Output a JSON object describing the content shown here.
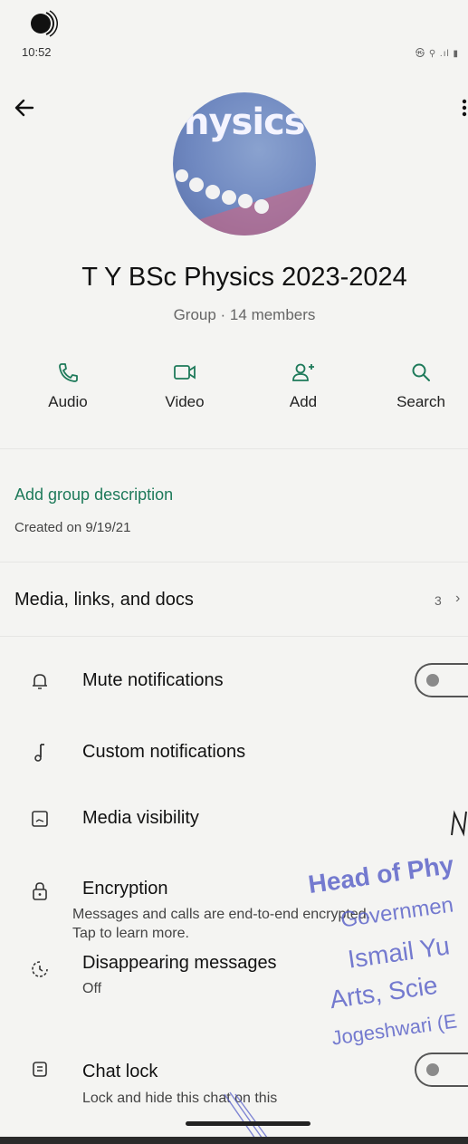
{
  "status_bar": {
    "time": "10:52",
    "icons_text": "㉿ ⚲ .ıl ▮"
  },
  "group": {
    "name": "T Y BSc Physics 2023-2024",
    "subtitle": "Group · 14 members",
    "avatar_text": "hysics"
  },
  "actions": [
    {
      "label": "Audio",
      "icon": "phone-icon"
    },
    {
      "label": "Video",
      "icon": "video-icon"
    },
    {
      "label": "Add",
      "icon": "add-person-icon"
    },
    {
      "label": "Search",
      "icon": "search-icon"
    }
  ],
  "description": {
    "add_link": "Add group description",
    "created": "Created on 9/19/21"
  },
  "media": {
    "title": "Media, links, and docs",
    "count": "3",
    "chevron": "›"
  },
  "settings": {
    "mute": {
      "title": "Mute notifications"
    },
    "custom": {
      "title": "Custom notifications"
    },
    "visibility": {
      "title": "Media visibility"
    },
    "encryption": {
      "title": "Encryption",
      "subtitle_line1": "Messages and calls are end-to-end encrypted.",
      "subtitle_line2": "Tap to learn more."
    },
    "disappearing": {
      "title": "Disappearing messages",
      "value": "Off"
    },
    "chat_lock": {
      "title": "Chat lock",
      "subtitle": "Lock and hide this chat on this"
    }
  },
  "stamp": {
    "line1": "Head of Phy",
    "line2": "Governmen",
    "line3": "Ismail Yu",
    "line4": "Arts, Scie",
    "line5": "Jogeshwari (E"
  },
  "colors": {
    "accent": "#1e7a5a",
    "stamp": "#5860c8"
  }
}
